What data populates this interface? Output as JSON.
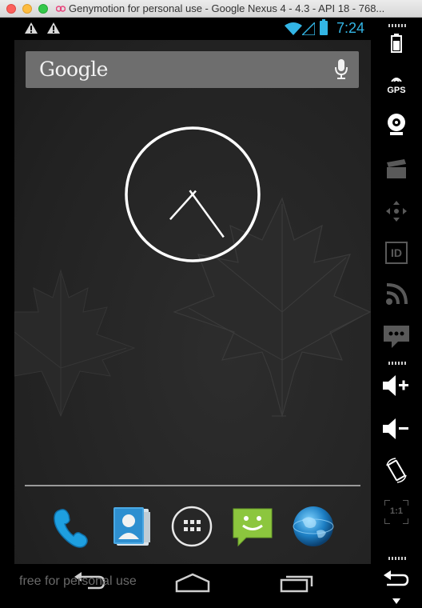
{
  "window": {
    "title": "Genymotion for personal use - Google Nexus 4 - 4.3 - API 18 - 768..."
  },
  "statusbar": {
    "time": "7:24",
    "accent_color": "#33b5e5"
  },
  "search": {
    "logo_text": "Google",
    "mic_icon": "mic-icon"
  },
  "clock": {
    "hour": 7,
    "minute": 24
  },
  "dock": {
    "apps": [
      "phone-icon",
      "contacts-icon",
      "all-apps-icon",
      "messaging-icon",
      "browser-globe-icon"
    ]
  },
  "navbar": {
    "watermark": "free for personal use",
    "buttons": [
      "back-icon",
      "home-icon",
      "recent-apps-icon"
    ]
  },
  "sidebar": {
    "gps_label": "GPS",
    "id_label": "ID",
    "pixel_label": "1:1",
    "buttons": [
      "battery-icon",
      "gps-icon",
      "webcam-icon",
      "video-capture-icon",
      "remote-control-icon",
      "device-id-icon",
      "network-icon",
      "sms-icon",
      "volume-up-icon",
      "volume-down-icon",
      "rotate-icon",
      "pixel-perfect-icon",
      "back-icon"
    ]
  }
}
